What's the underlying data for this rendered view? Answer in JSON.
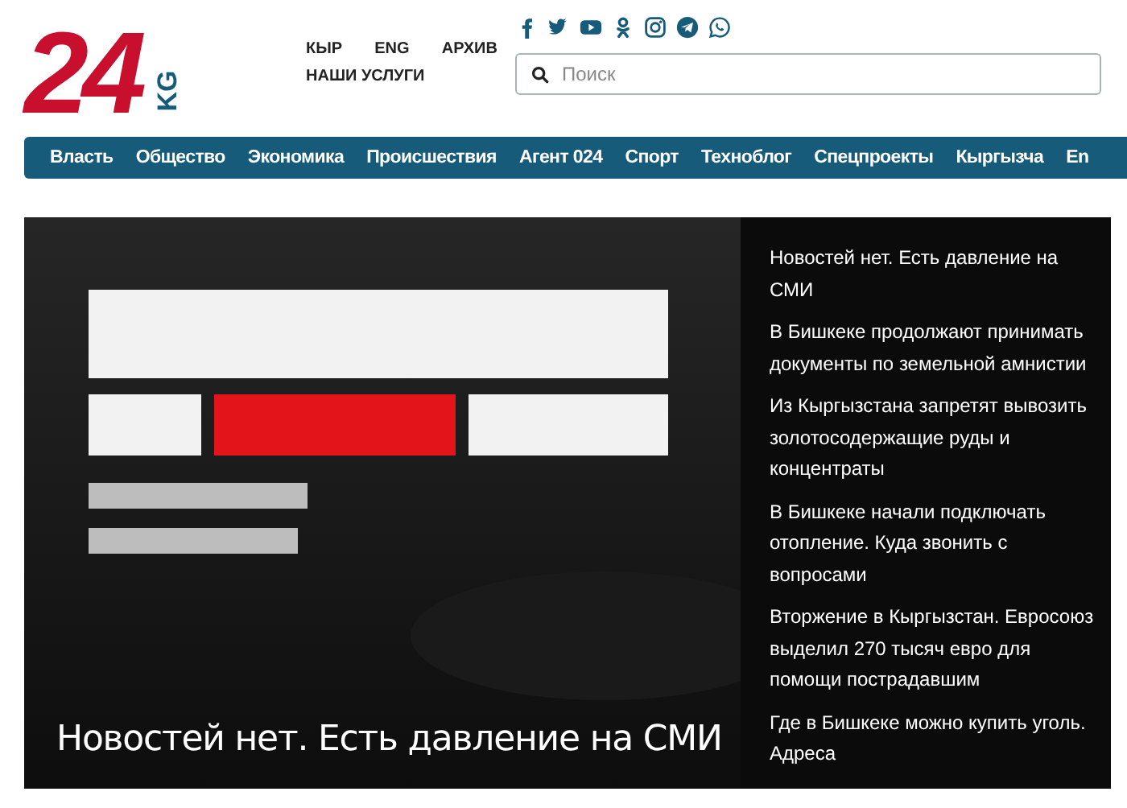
{
  "logo": {
    "mark": "24",
    "suffix": "KG"
  },
  "top_links": [
    {
      "label": "КЫР"
    },
    {
      "label": "ENG"
    },
    {
      "label": "АРХИВ"
    },
    {
      "label": "НАШИ УСЛУГИ"
    }
  ],
  "social": [
    {
      "kind": "facebook"
    },
    {
      "kind": "twitter"
    },
    {
      "kind": "youtube"
    },
    {
      "kind": "odnoklassniki"
    },
    {
      "kind": "instagram"
    },
    {
      "kind": "telegram"
    },
    {
      "kind": "whatsapp"
    }
  ],
  "search": {
    "placeholder": "Поиск"
  },
  "nav": [
    "Власть",
    "Общество",
    "Экономика",
    "Происшествия",
    "Агент 024",
    "Спорт",
    "Техноблог",
    "Спецпроекты",
    "Кыргызча",
    "En"
  ],
  "featured": {
    "kind": "picture",
    "caption": "Новостей нет. Есть давление на СМИ"
  },
  "headlines": [
    "Новостей нет. Есть давление на СМИ",
    "В Бишкеке продолжают принимать документы по земельной амнистии",
    "Из Кыргызстана запретят вывозить золотосодержащие руды и концентраты",
    "В Бишкеке начали подключать отопление. Куда звонить с вопросами",
    "Вторжение в Кыргызстан. Евросоюз выделил 270 тысяч евро для помощи пострадавшим",
    "Где в Бишкеке можно купить уголь. Адреса"
  ]
}
